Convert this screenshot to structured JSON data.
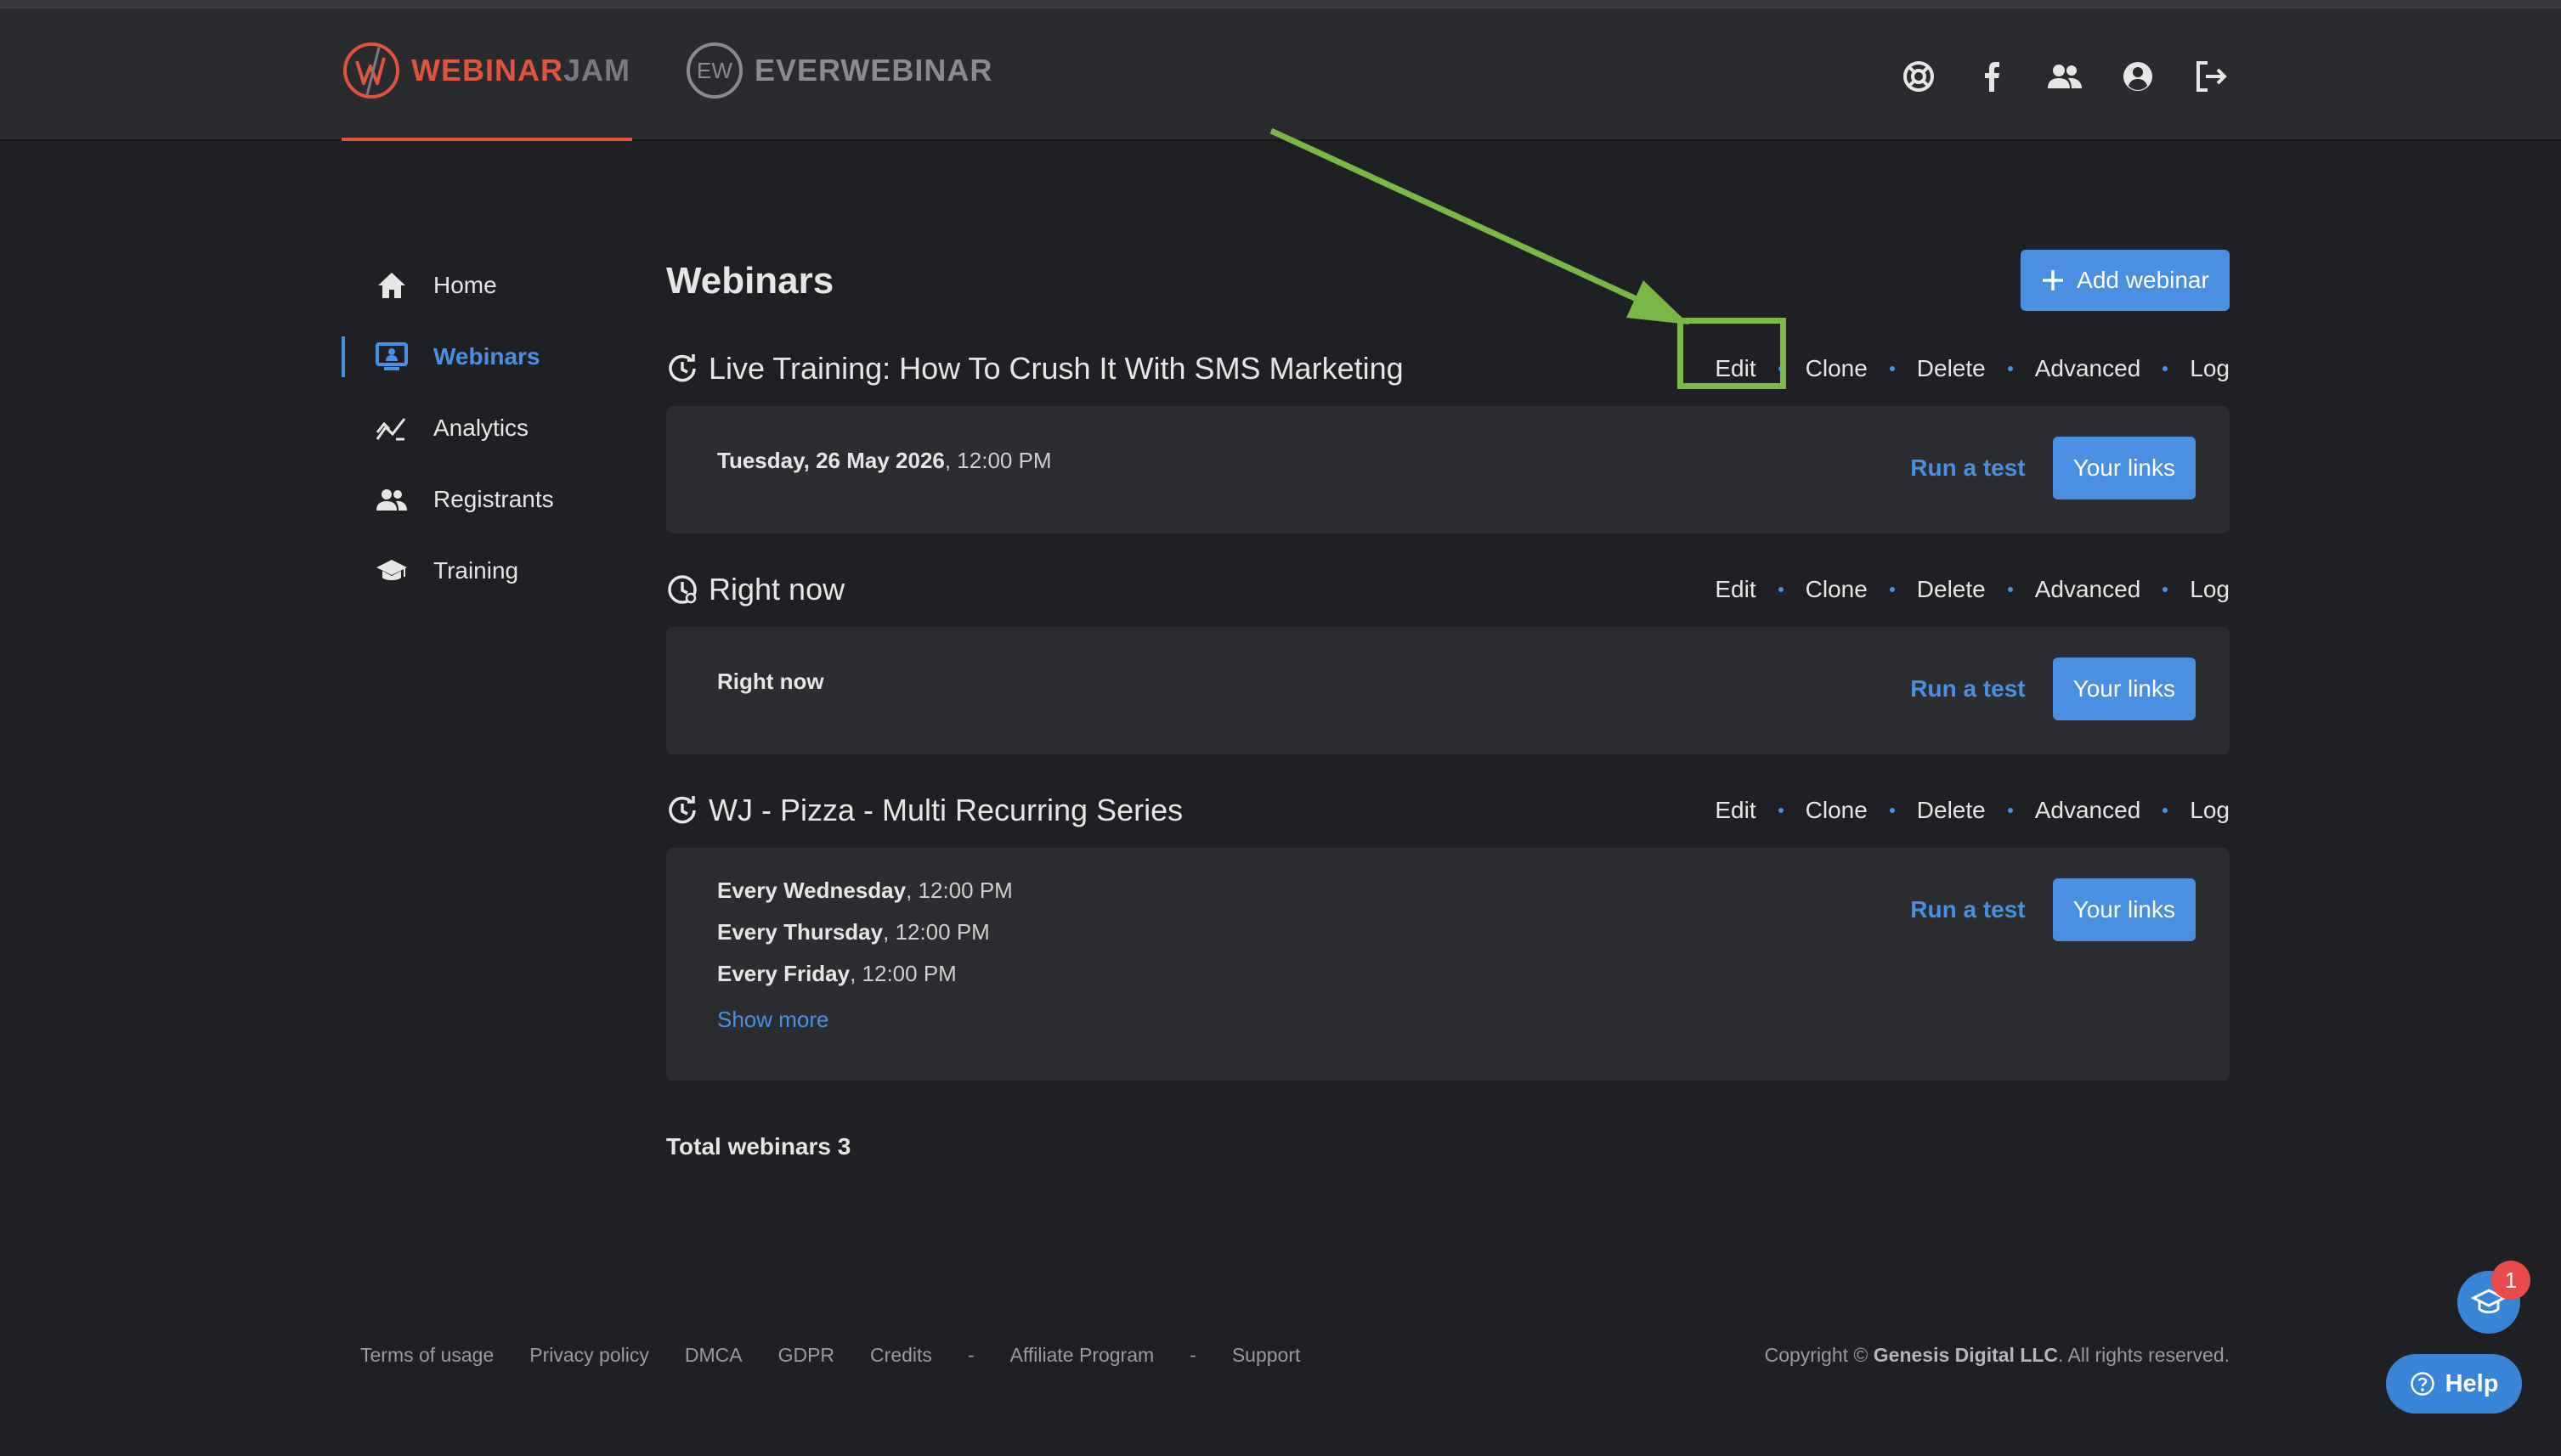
{
  "header": {
    "brand_primary_a": "WEBINAR",
    "brand_primary_b": "JAM",
    "brand_secondary": "EVERWEBINAR",
    "icons": [
      "support-icon",
      "facebook-icon",
      "team-icon",
      "account-icon",
      "logout-icon"
    ]
  },
  "sidebar": {
    "items": [
      {
        "label": "Home",
        "icon": "home-icon"
      },
      {
        "label": "Webinars",
        "icon": "monitor-icon",
        "active": true
      },
      {
        "label": "Analytics",
        "icon": "analytics-icon"
      },
      {
        "label": "Registrants",
        "icon": "people-icon"
      },
      {
        "label": "Training",
        "icon": "graduation-cap-icon"
      }
    ]
  },
  "main": {
    "title": "Webinars",
    "add_button": "Add webinar",
    "actions": {
      "edit": "Edit",
      "clone": "Clone",
      "delete": "Delete",
      "advanced": "Advanced",
      "log": "Log"
    },
    "run_test": "Run a test",
    "your_links": "Your links",
    "webinars": [
      {
        "title": "Live Training: How To Crush It With SMS Marketing",
        "schedule": [
          {
            "day": "Tuesday, 26 May 2026",
            "time": ", 12:00 PM"
          }
        ]
      },
      {
        "title": "Right now",
        "schedule": [
          {
            "day": "Right now",
            "time": ""
          }
        ]
      },
      {
        "title": "WJ - Pizza - Multi Recurring Series",
        "schedule": [
          {
            "day": "Every Wednesday",
            "time": ", 12:00 PM"
          },
          {
            "day": "Every Thursday",
            "time": ", 12:00 PM"
          },
          {
            "day": "Every Friday",
            "time": ", 12:00 PM"
          }
        ],
        "show_more": "Show more"
      }
    ],
    "total": "Total webinars 3"
  },
  "footer": {
    "links": [
      "Terms of usage",
      "Privacy policy",
      "DMCA",
      "GDPR",
      "Credits",
      "-",
      "Affiliate Program",
      "-",
      "Support"
    ],
    "copyright_prefix": "Copyright © ",
    "company": "Genesis Digital LLC",
    "copyright_suffix": ". All rights reserved."
  },
  "widgets": {
    "badge_count": "1",
    "help_label": "Help"
  },
  "colors": {
    "accent": "#4a90e2",
    "brand": "#e0533f",
    "highlight": "#7ab648"
  }
}
